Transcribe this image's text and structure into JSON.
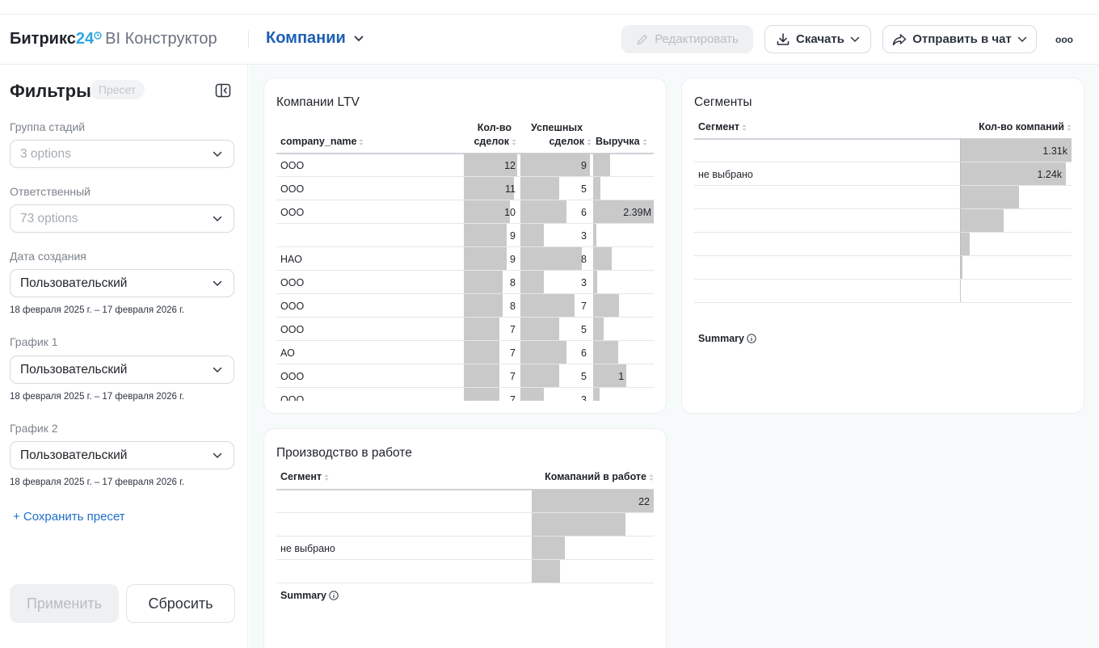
{
  "header": {
    "brand_name": "Битрикс",
    "brand_num": "24",
    "brand_product": "BI Конструктор",
    "dashboard_title": "Компании",
    "edit_label": "Редактировать",
    "download_label": "Скачать",
    "send_label": "Отправить в чат",
    "more_label": "ooo"
  },
  "filters": {
    "title": "Фильтры",
    "preset_badge": "Пресет",
    "items": [
      {
        "label": "Группа стадий",
        "value": "3 options"
      },
      {
        "label": "Ответственный",
        "value": "73 options"
      },
      {
        "label": "Дата создания",
        "value": "Пользовательский",
        "date_range": "18 февраля 2025 г. – 17 февраля 2026 г."
      },
      {
        "label": "График 1",
        "value": "Пользовательский",
        "date_range": "18 февраля 2025 г. – 17 февраля 2026 г."
      },
      {
        "label": "График 2",
        "value": "Пользовательский",
        "date_range": "18 февраля 2025 г. – 17 февраля 2026 г."
      }
    ],
    "save_preset": "+ Сохранить пресет",
    "apply_label": "Применить",
    "reset_label": "Сбросить"
  },
  "ltv": {
    "title": "Компании LTV",
    "columns": {
      "name": "company_name",
      "deals_1": "Кол-во",
      "deals_2": "сделок",
      "won_1": "Успешных",
      "won_2": "сделок",
      "revenue": "Выручка"
    },
    "rows": [
      {
        "name": "ООО",
        "deals": 12,
        "won": 9,
        "revenue": 0.28,
        "revenue_label": ""
      },
      {
        "name": "ООО",
        "deals": 11,
        "won": 5,
        "revenue": 0.12,
        "revenue_label": ""
      },
      {
        "name": "ООО",
        "deals": 10,
        "won": 6,
        "revenue": 1.0,
        "revenue_label": "2.39M"
      },
      {
        "name": "",
        "deals": 9,
        "won": 3,
        "revenue": 0.05,
        "revenue_label": ""
      },
      {
        "name": "НАО",
        "deals": 9,
        "won": 8,
        "revenue": 0.3,
        "revenue_label": ""
      },
      {
        "name": "ООО",
        "deals": 8,
        "won": 3,
        "revenue": 0.06,
        "revenue_label": ""
      },
      {
        "name": "ООО",
        "deals": 8,
        "won": 7,
        "revenue": 0.42,
        "revenue_label": ""
      },
      {
        "name": "ООО",
        "deals": 7,
        "won": 5,
        "revenue": 0.17,
        "revenue_label": ""
      },
      {
        "name": "АО",
        "deals": 7,
        "won": 6,
        "revenue": 0.41,
        "revenue_label": ""
      },
      {
        "name": "ООО",
        "deals": 7,
        "won": 5,
        "revenue": 0.55,
        "revenue_label": "1"
      },
      {
        "name": "ООО",
        "deals": 7,
        "won": 3,
        "revenue": 0.1,
        "revenue_label": ""
      }
    ]
  },
  "segments": {
    "title": "Сегменты",
    "columns": {
      "segment": "Сегмент",
      "count": "Кол-во компаний"
    },
    "rows": [
      {
        "segment": "",
        "value": 1.0,
        "label": "1.31k"
      },
      {
        "segment": "не выбрано",
        "value": 0.95,
        "label": "1.24k"
      },
      {
        "segment": "",
        "value": 0.53,
        "label": ""
      },
      {
        "segment": "",
        "value": 0.39,
        "label": ""
      },
      {
        "segment": "",
        "value": 0.09,
        "label": ""
      },
      {
        "segment": "",
        "value": 0.02,
        "label": ""
      },
      {
        "segment": "",
        "value": 0.005,
        "label": ""
      }
    ],
    "summary": "Summary"
  },
  "production": {
    "title": "Производство в работе",
    "columns": {
      "segment": "Сегмент",
      "count": "Комапаний в работе"
    },
    "rows": [
      {
        "segment": "",
        "value": 1.0,
        "label": "22"
      },
      {
        "segment": "",
        "value": 0.77,
        "label": ""
      },
      {
        "segment": "не выбрано",
        "value": 0.27,
        "label": ""
      },
      {
        "segment": "",
        "value": 0.23,
        "label": ""
      }
    ],
    "summary": "Summary"
  }
}
